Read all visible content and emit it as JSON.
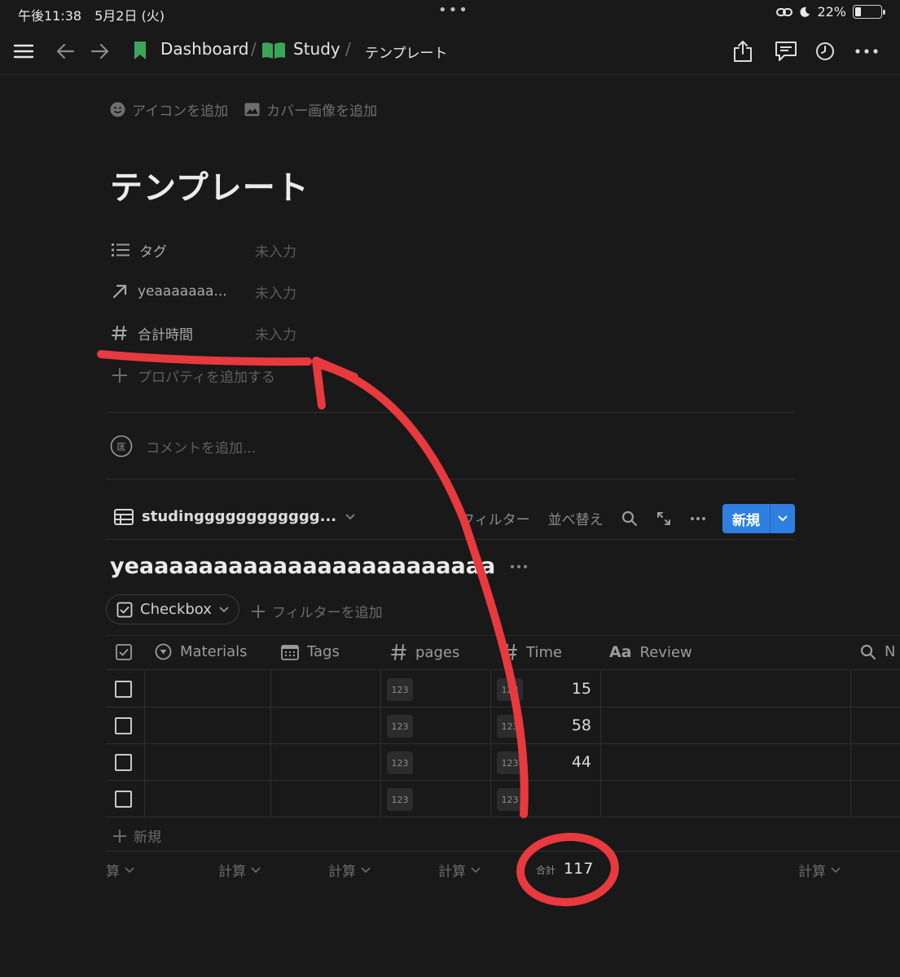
{
  "status_bar": {
    "time_date": "午後11:38　5月2日 (火)",
    "battery": "22%",
    "battery_level": 0.22
  },
  "nav": {
    "breadcrumb": [
      "Dashboard",
      "Study",
      "テンプレート"
    ]
  },
  "page": {
    "add_icon": "アイコンを追加",
    "add_cover": "カバー画像を追加",
    "title": "テンプレート",
    "properties": [
      {
        "name": "タグ",
        "icon": "list-icon",
        "value": "未入力"
      },
      {
        "name": "yeaaaaaaa...",
        "icon": "relation-arrow-icon",
        "value": "未入力"
      },
      {
        "name": "合計時間",
        "icon": "number-hash-icon",
        "value": "未入力"
      }
    ],
    "add_property": "プロパティを追加する",
    "add_comment": "コメントを追加..."
  },
  "database": {
    "source_name": "studingggggggggggg...",
    "filter": "フィルター",
    "sort": "並べ替え",
    "new_button": "新規",
    "view_title": "yeaaaaaaaaaaaaaaaaaaaaaaaa",
    "filter_chip": "Checkbox",
    "add_filter": "フィルターを追加",
    "columns": [
      "Materials",
      "Tags",
      "pages",
      "Time",
      "Review",
      "N"
    ],
    "number_badge": "123",
    "rows": [
      {
        "time": "15"
      },
      {
        "time": "58"
      },
      {
        "time": "44"
      },
      {
        "time": ""
      }
    ],
    "new_row": "新規",
    "calc_label": "計算",
    "calc_first": "算",
    "sum_label": "合計",
    "sum_value": "117"
  },
  "annotation_color": "#e8393f"
}
